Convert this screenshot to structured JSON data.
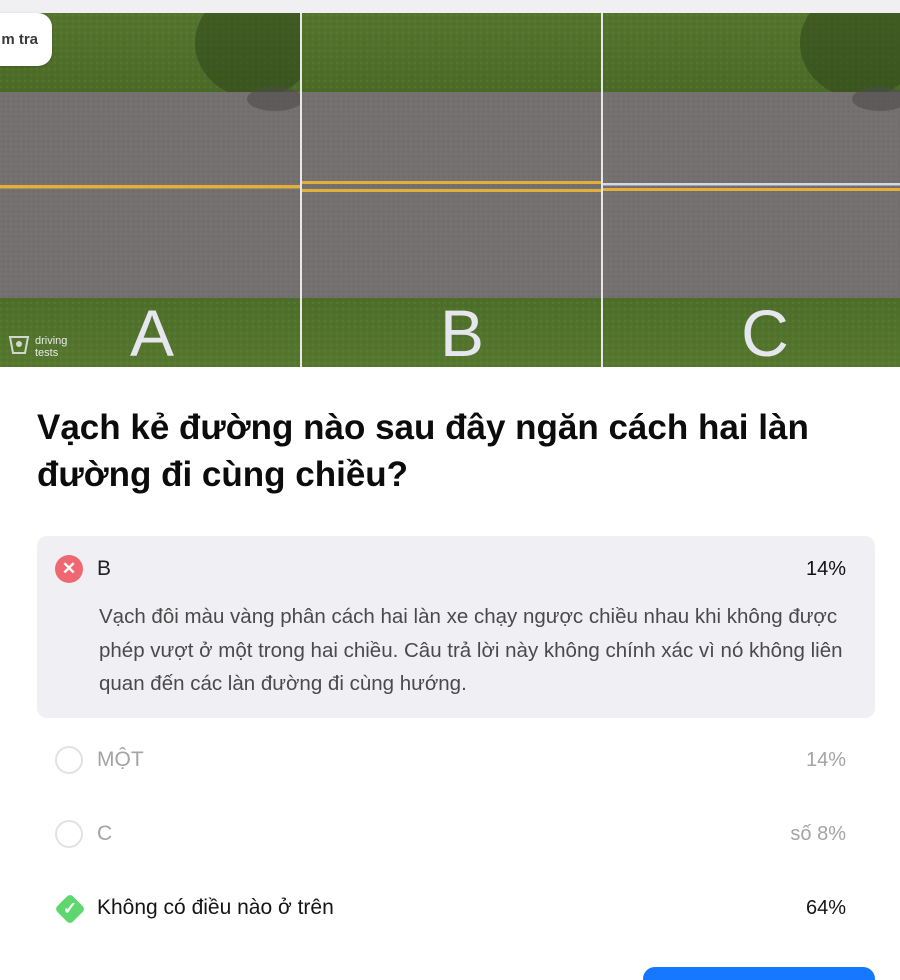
{
  "header": {
    "check_label": "m tra"
  },
  "image": {
    "brand_line1": "driving",
    "brand_line2": "tests",
    "panels": [
      {
        "letter": "A"
      },
      {
        "letter": "B"
      },
      {
        "letter": "C"
      }
    ]
  },
  "question": {
    "text": "Vạch kẻ đường nào sau đây ngăn cách hai làn đường đi cùng chiều?"
  },
  "answers": [
    {
      "label": "B",
      "percent": "14%",
      "state": "wrong-selected",
      "explanation": "Vạch đôi màu vàng phân cách hai làn xe chạy ngược chiều nhau khi không được phép vượt ở một trong hai chiều. Câu trả lời này không chính xác vì nó không liên quan đến các làn đường đi cùng hướng."
    },
    {
      "label": "MỘT",
      "percent": "14%",
      "state": "neutral"
    },
    {
      "label": "C",
      "percent": "số 8%",
      "state": "neutral"
    },
    {
      "label": "Không có điều nào ở trên",
      "percent": "64%",
      "state": "correct"
    }
  ],
  "colors": {
    "wrong": "#ee6872",
    "correct": "#5fd76f",
    "primary": "#1677ff",
    "selected_bg": "#f0f0f4"
  },
  "icons": [
    "close-icon",
    "check-icon",
    "radio-empty-icon",
    "driving-tests-logo-icon"
  ]
}
